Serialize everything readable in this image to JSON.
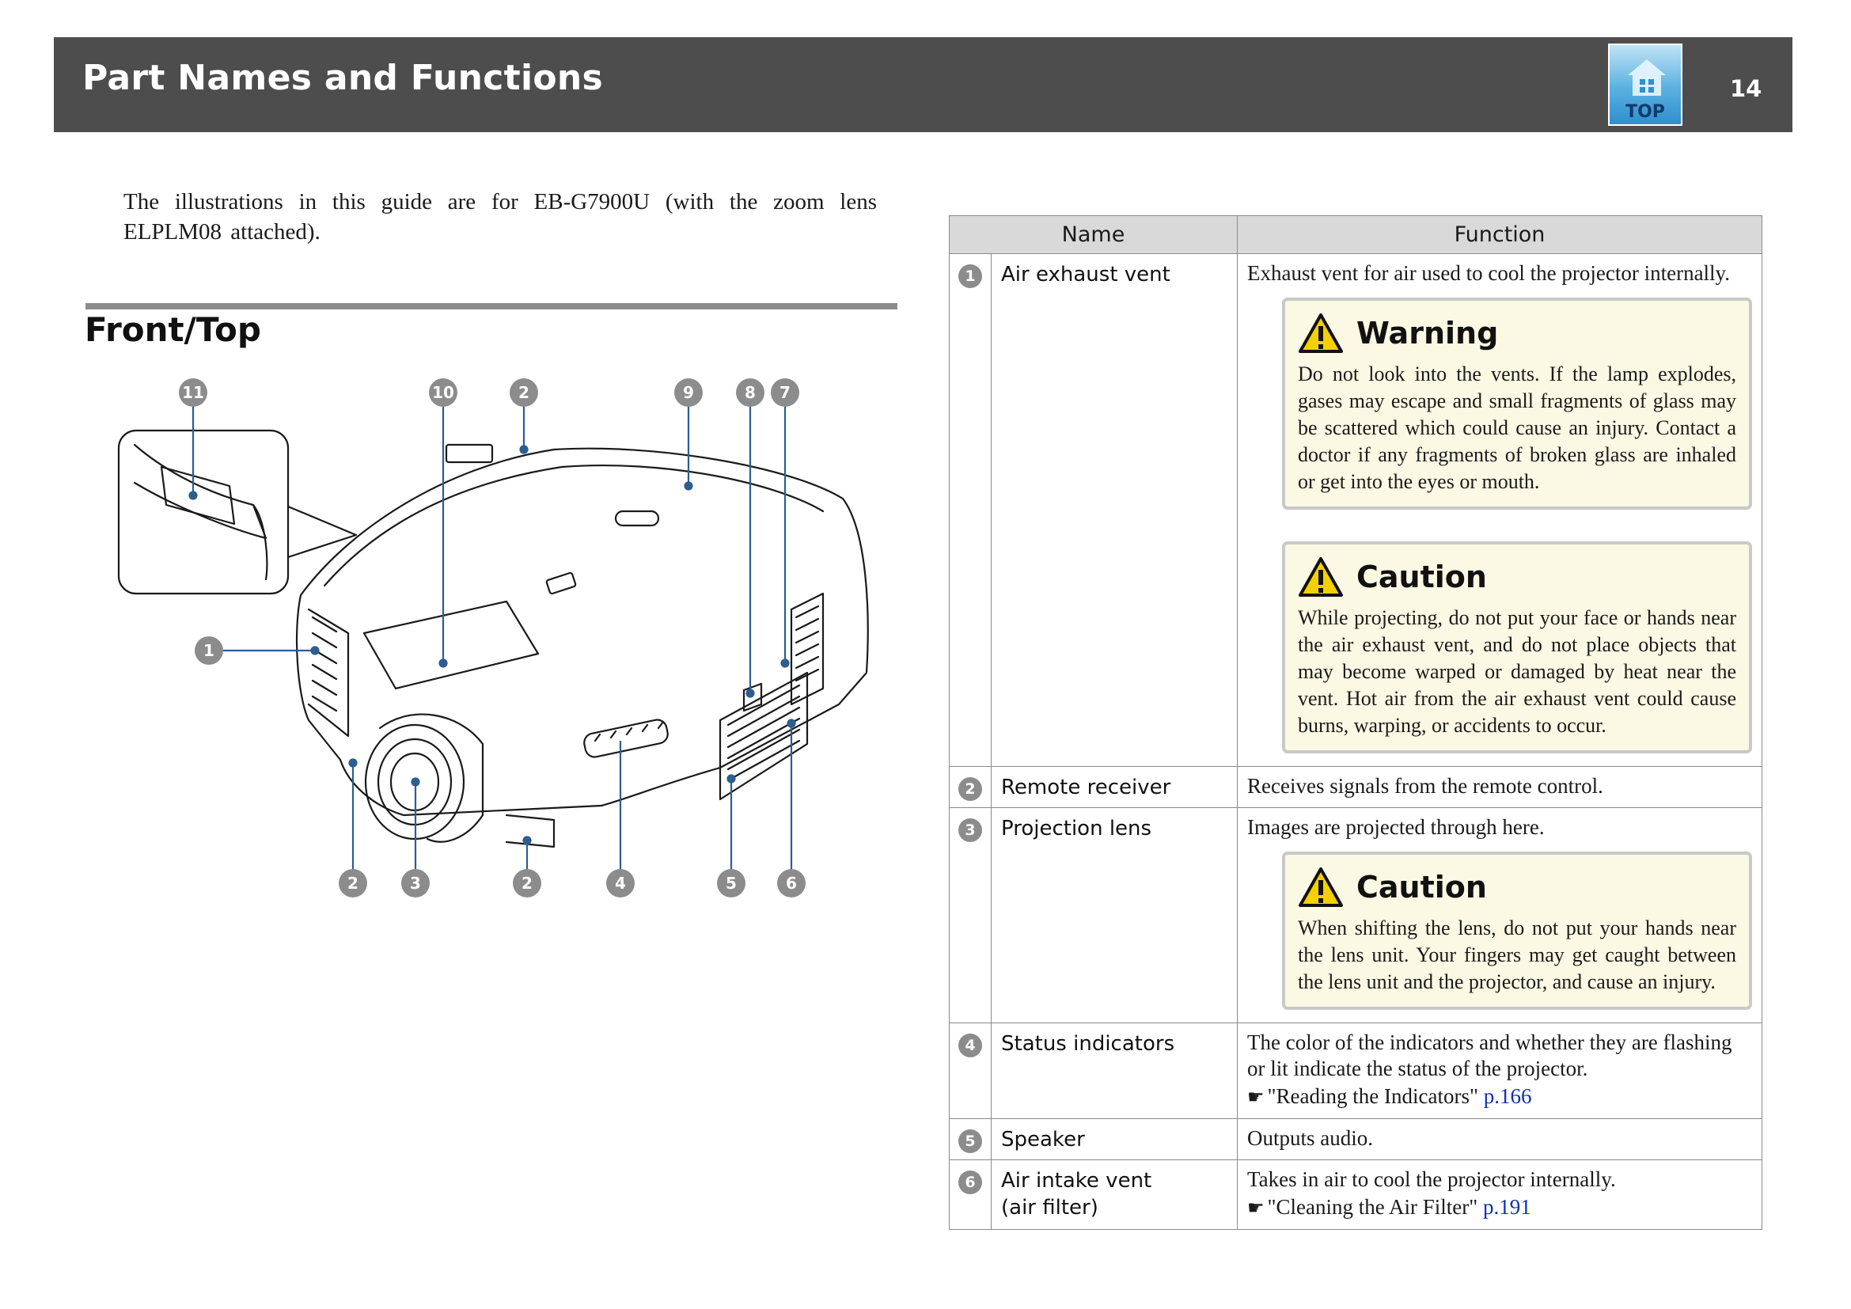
{
  "header": {
    "title": "Part Names and Functions",
    "top_label": "TOP",
    "page_number": "14"
  },
  "intro": "The illustrations in this guide are for EB-G7900U (with the zoom lens ELPLM08 attached).",
  "section": {
    "title": "Front/Top"
  },
  "figure": {
    "callouts": {
      "c11": "11",
      "c10": "10",
      "c2a": "2",
      "c9": "9",
      "c8": "8",
      "c7": "7",
      "c1": "1",
      "c2b": "2",
      "c3": "3",
      "c2c": "2",
      "c4": "4",
      "c5": "5",
      "c6": "6"
    }
  },
  "table": {
    "headers": {
      "name": "Name",
      "function": "Function"
    },
    "rows": [
      {
        "num": "1",
        "name": "Air exhaust vent",
        "function": "Exhaust vent for air used to cool the projector internally.",
        "notices": [
          {
            "title": "Warning",
            "text": "Do not look into the vents. If the lamp explodes, gases may escape and small fragments of glass may be scattered which could cause an injury. Contact a doctor if any fragments of broken glass are inhaled or get into the eyes or mouth."
          },
          {
            "title": "Caution",
            "text": "While projecting, do not put your face or hands near the air exhaust vent, and do not place objects that may become warped or damaged by heat near the vent. Hot air from the air exhaust vent could cause burns, warping, or accidents to occur."
          }
        ]
      },
      {
        "num": "2",
        "name": "Remote receiver",
        "function": "Receives signals from the remote control."
      },
      {
        "num": "3",
        "name": "Projection lens",
        "function": "Images are projected through here.",
        "notices": [
          {
            "title": "Caution",
            "text": "When shifting the lens, do not put your hands near the lens unit. Your fingers may get caught between the lens unit and the projector, and cause an injury."
          }
        ]
      },
      {
        "num": "4",
        "name": "Status indicators",
        "function": "The color of the indicators and whether they are flashing or lit indicate the status of the projector.",
        "ref": {
          "text": "\"Reading the Indicators\"",
          "link": "p.166"
        }
      },
      {
        "num": "5",
        "name": "Speaker",
        "function": "Outputs audio."
      },
      {
        "num": "6",
        "name": "Air intake vent\n(air filter)",
        "function": "Takes in air to cool the projector internally.",
        "ref": {
          "text": "\"Cleaning the Air Filter\"",
          "link": "p.191"
        }
      }
    ]
  },
  "colors": {
    "header_bg": "#4d4d4d",
    "notice_bg": "#fbf8e3",
    "callout": "#8c8c8c",
    "leader": "#2e5d8f",
    "link": "#0d2fb5"
  }
}
